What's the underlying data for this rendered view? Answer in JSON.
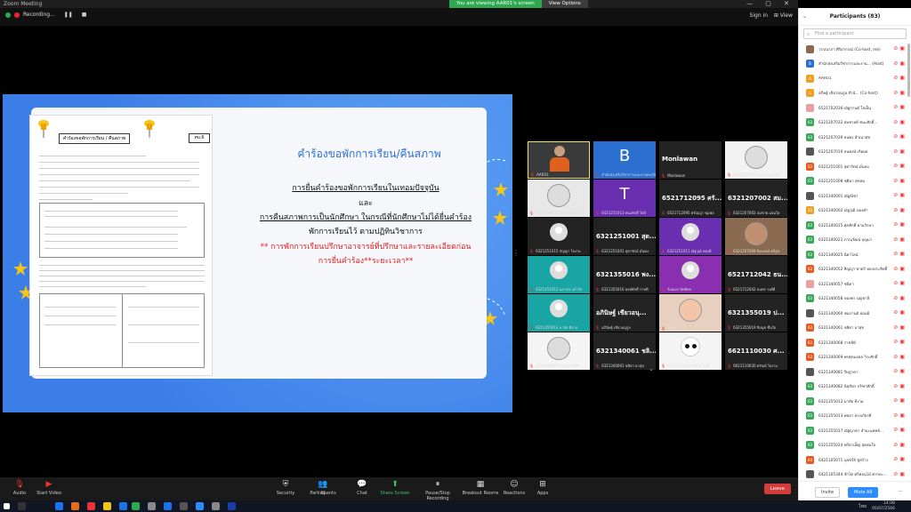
{
  "window": {
    "app_title": "Zoom Meeting"
  },
  "top": {
    "recording_label": "Recording...",
    "share_message": "You are viewing AAR01's screen",
    "view_options": "View Options",
    "sign_in": "Sign in",
    "view_label": "View"
  },
  "slide": {
    "title": "คำร้องขอพักการเรียน/คืนสภาพ",
    "line1": "การยื่นคำร้องขอพักการเรียนในเทอมปัจจุบัน",
    "line2": "และ",
    "line3": "การคืนสภาพการเป็นนักศึกษา ในกรณีที่นักศึกษาไม่ได้ยื่นคำร้อง",
    "line4": "พักการเรียนไว้ ตามปฏิทินวิชาการ",
    "line5": "** การพักการเรียนปรึกษาอาจารย์ที่ปรึกษาและรายละเอียดก่อน",
    "line6": "การยื่นคำร้อง**ระยะเวลา**",
    "form_title": "คำร้องขอพักการเรียน / คืนสภาพ",
    "form_code": "ทบ.6"
  },
  "gallery": [
    {
      "label": "AAR01",
      "big": "",
      "avatar": "person",
      "color": "#3a3a3a",
      "active": true
    },
    {
      "label": "สำนักส่งเสริมวิชาการและงานทะเบียน",
      "big": "B",
      "avatar": "letter",
      "color": "#2b6fd1"
    },
    {
      "label": "Monlawan",
      "big": "Monlawan",
      "avatar": "text",
      "color": "#232323"
    },
    {
      "label": "6621121011 ชนะธร รุ่งเรือง",
      "big": "",
      "avatar": "photo",
      "color": "#f2f2f2"
    },
    {
      "label": "6521712001 วนิดา ยิ่งทอง",
      "big": "",
      "avatar": "glasses",
      "color": "#e8e8e8"
    },
    {
      "label": "6421251013 ทนงศักดิ์ ใจดี",
      "big": "T",
      "avatar": "letter",
      "color": "#6a2fb0"
    },
    {
      "label": "6521712095 ศรัณญ่า ชุมพล",
      "big": "6521712095 ศรั...",
      "avatar": "text",
      "color": "#232323"
    },
    {
      "label": "6321207002 สมชาย แจ่มใส",
      "big": "6321207002 สม...",
      "avatar": "text",
      "color": "#232323"
    },
    {
      "label": "6321251015 กัญญา ใจงาม",
      "big": "",
      "avatar": "user",
      "color": "#232323"
    },
    {
      "label": "6321251001 สุดารัตน์ มั่นคง",
      "big": "6321251001 สุด...",
      "avatar": "text",
      "color": "#232323"
    },
    {
      "label": "6321251011 ณัฐวุฒิ ทองดี",
      "big": "",
      "avatar": "user",
      "color": "#6a2fb0"
    },
    {
      "label": "6321207009 ปิยะพงษ์ ศรีสุข",
      "big": "",
      "avatar": "photo2",
      "color": "#8a6a50"
    },
    {
      "label": "6321251012 นภาพร แก้วใส",
      "big": "",
      "avatar": "user",
      "color": "#1aa5a5"
    },
    {
      "label": "6321355016 พงษ์ศักดิ์ ราชดี",
      "big": "6321355016 พง...",
      "avatar": "text",
      "color": "#232323"
    },
    {
      "label": "ร้อยเอก อิทธิพล",
      "big": "",
      "avatar": "user",
      "color": "#8a2fb0"
    },
    {
      "label": "6521712042 ธนพร วงศ์ดี",
      "big": "6521712042 ธน...",
      "avatar": "text",
      "color": "#232323"
    },
    {
      "label": "6321355012 มาลัย ดีงาม",
      "big": "",
      "avatar": "user",
      "color": "#1aa5a5"
    },
    {
      "label": "อภินิษฐ์ เขียวอนุกูล",
      "big": "อภินิษฐ์ เขียวอนุ...",
      "avatar": "text",
      "color": "#232323"
    },
    {
      "label": "Annorchiid",
      "big": "",
      "avatar": "photo3",
      "color": "#e8d0c0"
    },
    {
      "label": "6321355019 ปิยนุช ชื่นใจ",
      "big": "6321355019 ป...",
      "avatar": "text",
      "color": "#232323"
    },
    {
      "label": "6221340027 วรรณา สุขดี",
      "big": "",
      "avatar": "sketch",
      "color": "#f4f4f4"
    },
    {
      "label": "6321340061 ชลิตา ผาสุข",
      "big": "6321340061 ชลิ...",
      "avatar": "text",
      "color": "#232323"
    },
    {
      "label": "6421701021 ชลธิชา ใจดี",
      "big": "",
      "avatar": "panda",
      "color": "#f4f4f4"
    },
    {
      "label": "6621110030 ศรัณย์ ใจงาม",
      "big": "6621110030 ศ...",
      "avatar": "text",
      "color": "#232323"
    }
  ],
  "toolbar": {
    "audio": "Audio",
    "video": "Start Video",
    "security": "Security",
    "participants": "Participants",
    "participants_count": "83",
    "chat": "Chat",
    "share": "Share Screen",
    "record": "Pause/Stop Recording",
    "breakout": "Breakout Rooms",
    "reactions": "Reactions",
    "apps": "Apps",
    "leave": "Leave"
  },
  "panel": {
    "title": "Participants (83)",
    "search_placeholder": "Find a participant",
    "invite": "Invite",
    "mute_all": "Mute All",
    "more": "...",
    "participants": [
      {
        "name": "วรรณาภา ศิริยากรณ์ (Co-host, me)",
        "color": "#8a6a50",
        "initial": ""
      },
      {
        "name": "สำนักส่งเสริมวิชาการและงาน... (Host)",
        "color": "#2b6fd1",
        "initial": "B"
      },
      {
        "name": "AAR01",
        "color": "#f0a020",
        "initial": "A"
      },
      {
        "name": "อภิษฐ์ เขียวอนุกูล สำนั... (Co-host)",
        "color": "#f0a020",
        "initial": "อ"
      },
      {
        "name": "6521702036-ณัฐกานต์ ใจเย็น",
        "color": "#e8a0a0",
        "initial": ""
      },
      {
        "name": "6321207032 สมชายดี ชนะศักดิ์...",
        "color": "#3aa85a",
        "initial": "63"
      },
      {
        "name": "6321207039 ธนพร สำเนาสุข",
        "color": "#3aa85a",
        "initial": "63"
      },
      {
        "name": "6321207016 ธนพงษ์ เกิดผล",
        "color": "#555",
        "initial": ""
      },
      {
        "name": "6321251001 สุดารัตน์ มั่นคง",
        "color": "#e85a20",
        "initial": "63"
      },
      {
        "name": "6321251008 ชุติมา สุขสม",
        "color": "#3aa85a",
        "initial": "63"
      },
      {
        "name": "6321340001 ณัฐณิชา",
        "color": "#555",
        "initial": ""
      },
      {
        "name": "6321340002 ณัฐวุฒิ ทองคำ",
        "color": "#f0a020",
        "initial": "63"
      },
      {
        "name": "6321340015 ศุภศักดิ์ ยานรักษา",
        "color": "#3aa85a",
        "initial": "63"
      },
      {
        "name": "6321340021 ภาณุวัฒน์ บุญมา",
        "color": "#3aa85a",
        "initial": "63"
      },
      {
        "name": "6321340025 นิดาไลน์",
        "color": "#3aa85a",
        "initial": "63"
      },
      {
        "name": "6321340052 สิญญา ชาตรี ทองประสิทธิ์",
        "color": "#e85a20",
        "initial": "63"
      },
      {
        "name": "6321340057 ชนิดา",
        "color": "#e8a0a0",
        "initial": ""
      },
      {
        "name": "6321340058 ทองพา บุญชาลี",
        "color": "#3aa85a",
        "initial": "63"
      },
      {
        "name": "6321340060 ชนกานต์ ผ่อนผี",
        "color": "#555",
        "initial": ""
      },
      {
        "name": "6321340061 ชลิตา ผาสุข",
        "color": "#e85a20",
        "initial": "63"
      },
      {
        "name": "6321340068 ราชสีห์",
        "color": "#e85a20",
        "initial": "63"
      },
      {
        "name": "6321340069 พรศุภมงคล วีระศักดิ์",
        "color": "#e85a20",
        "initial": "63"
      },
      {
        "name": "6321340081 ริษฎาดา",
        "color": "#555",
        "initial": ""
      },
      {
        "name": "6321340082 นิสุภัทร กรีฑาศักดิ์",
        "color": "#3aa85a",
        "initial": "63"
      },
      {
        "name": "6321355012 มาลัย ดีงาม",
        "color": "#3aa85a",
        "initial": "63"
      },
      {
        "name": "6321355013 พลอา ทรงเกียรติ",
        "color": "#3aa85a",
        "initial": "63"
      },
      {
        "name": "6321355017 ณัฐญาดา ลำมะแพทย์...",
        "color": "#3aa85a",
        "initial": "63"
      },
      {
        "name": "6321355024 ฟรีดาเพ็ญ สุดสมใจ",
        "color": "#3aa85a",
        "initial": "63"
      },
      {
        "name": "6421105071 นุชจรีย์ ชูสร้าง",
        "color": "#e85a20",
        "initial": "64"
      },
      {
        "name": "6421105344 ชำโต ศรีคอนไม้ ศากยะ...",
        "color": "#555",
        "initial": ""
      }
    ]
  },
  "taskbar": {
    "time": "14:08",
    "date": "05/07/2566",
    "lang": "ไทย"
  }
}
